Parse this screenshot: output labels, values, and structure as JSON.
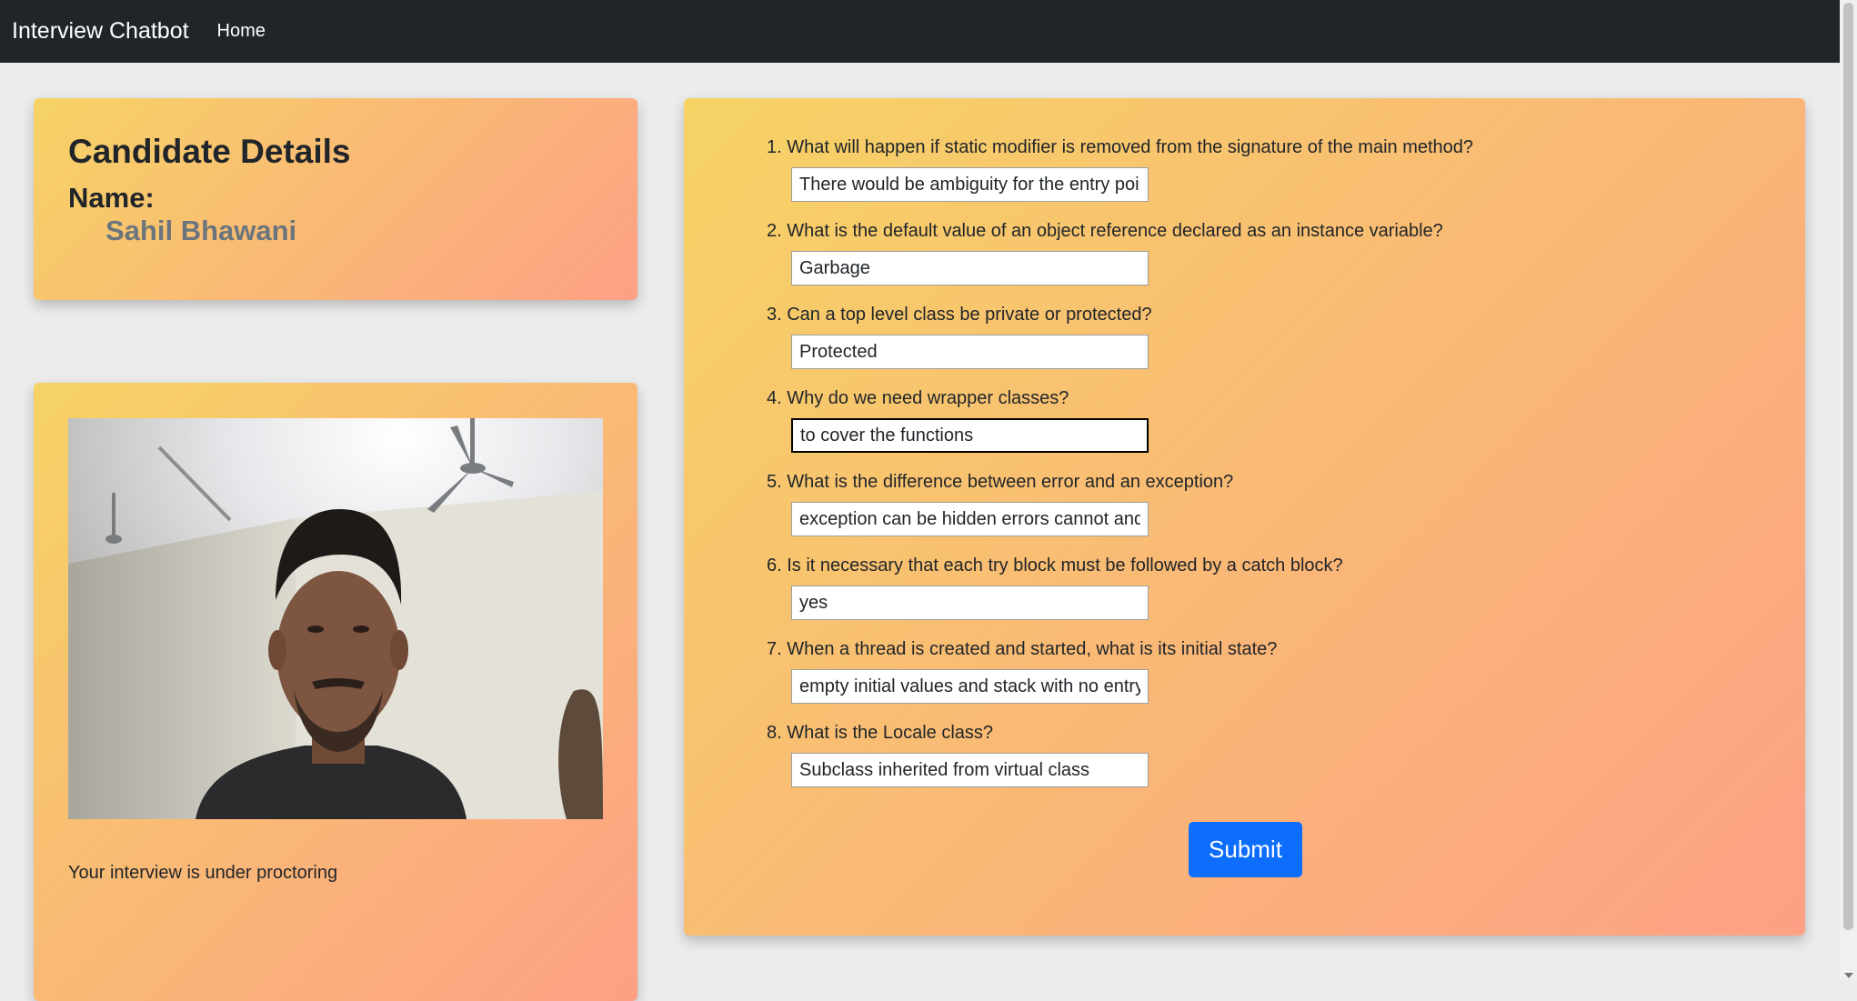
{
  "navbar": {
    "brand": "Interview Chatbot",
    "home_label": "Home"
  },
  "candidate": {
    "title": "Candidate Details",
    "name_label": "Name:",
    "name": "Sahil Bhawani"
  },
  "webcam": {
    "status_text": "Your interview is under proctoring"
  },
  "questions": [
    {
      "text": "1. What will happen if static modifier is removed from the signature of the main method?",
      "answer": "There would be ambiguity for the entry point"
    },
    {
      "text": "2. What is the default value of an object reference declared as an instance variable?",
      "answer": "Garbage"
    },
    {
      "text": "3. Can a top level class be private or protected?",
      "answer": "Protected"
    },
    {
      "text": "4. Why do we need wrapper classes?",
      "answer": "to cover the functions"
    },
    {
      "text": "5. What is the difference between error and an exception?",
      "answer": "exception can be hidden errors cannot and"
    },
    {
      "text": "6. Is it necessary that each try block must be followed by a catch block?",
      "answer": "yes"
    },
    {
      "text": "7. When a thread is created and started, what is its initial state?",
      "answer": "empty initial values and stack with no entry"
    },
    {
      "text": "8. What is the Locale class?",
      "answer": "Subclass inherited from virtual class"
    }
  ],
  "submit_label": "Submit",
  "colors": {
    "navbar_bg": "#212529",
    "card_gradient_start": "#f6d365",
    "card_gradient_end": "#fda085",
    "submit_bg": "#0d6efd",
    "name_color": "#6c757d"
  }
}
